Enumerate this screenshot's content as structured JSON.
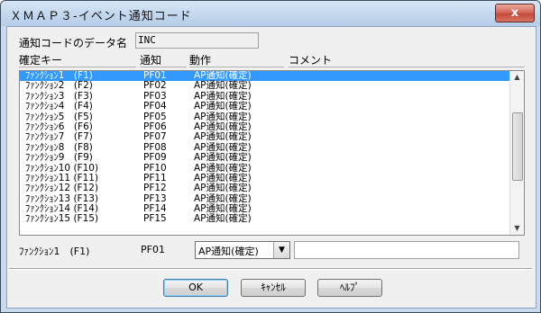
{
  "window": {
    "title": "ＸＭＡＰ３-イベント通知コード",
    "close_glyph": "x"
  },
  "notification": {
    "label": "通知コードのデータ名",
    "value": "INC"
  },
  "table": {
    "columns": [
      "確定キー",
      "通知",
      "動作",
      "コメント"
    ],
    "rows": [
      {
        "key": "ﾌｧﾝｸｼｮﾝ1　(F1)",
        "pf": "PF01",
        "action": "AP通知(確定)"
      },
      {
        "key": "ﾌｧﾝｸｼｮﾝ2　(F2)",
        "pf": "PF02",
        "action": "AP通知(確定)"
      },
      {
        "key": "ﾌｧﾝｸｼｮﾝ3　(F3)",
        "pf": "PF03",
        "action": "AP通知(確定)"
      },
      {
        "key": "ﾌｧﾝｸｼｮﾝ4　(F4)",
        "pf": "PF04",
        "action": "AP通知(確定)"
      },
      {
        "key": "ﾌｧﾝｸｼｮﾝ5　(F5)",
        "pf": "PF05",
        "action": "AP通知(確定)"
      },
      {
        "key": "ﾌｧﾝｸｼｮﾝ6　(F6)",
        "pf": "PF06",
        "action": "AP通知(確定)"
      },
      {
        "key": "ﾌｧﾝｸｼｮﾝ7　(F7)",
        "pf": "PF07",
        "action": "AP通知(確定)"
      },
      {
        "key": "ﾌｧﾝｸｼｮﾝ8　(F8)",
        "pf": "PF08",
        "action": "AP通知(確定)"
      },
      {
        "key": "ﾌｧﾝｸｼｮﾝ9　(F9)",
        "pf": "PF09",
        "action": "AP通知(確定)"
      },
      {
        "key": "ﾌｧﾝｸｼｮﾝ10 (F10)",
        "pf": "PF10",
        "action": "AP通知(確定)"
      },
      {
        "key": "ﾌｧﾝｸｼｮﾝ11 (F11)",
        "pf": "PF11",
        "action": "AP通知(確定)"
      },
      {
        "key": "ﾌｧﾝｸｼｮﾝ12 (F12)",
        "pf": "PF12",
        "action": "AP通知(確定)"
      },
      {
        "key": "ﾌｧﾝｸｼｮﾝ13 (F13)",
        "pf": "PF13",
        "action": "AP通知(確定)"
      },
      {
        "key": "ﾌｧﾝｸｼｮﾝ14 (F14)",
        "pf": "PF14",
        "action": "AP通知(確定)"
      },
      {
        "key": "ﾌｧﾝｸｼｮﾝ15 (F15)",
        "pf": "PF15",
        "action": "AP通知(確定)"
      }
    ],
    "selected_index": 0
  },
  "edit": {
    "key": "ﾌｧﾝｸｼｮﾝ1　(F1)",
    "pf": "PF01",
    "action_selected": "AP通知(確定)",
    "comment": ""
  },
  "buttons": {
    "ok": "OK",
    "cancel": "ｷｬﾝｾﾙ",
    "help": "ﾍﾙﾌﾟ"
  },
  "icons": {
    "close": "close-icon",
    "scroll_up": "chevron-up-icon",
    "scroll_down": "chevron-down-icon",
    "dropdown": "chevron-down-icon"
  },
  "colors": {
    "selection": "#3399ff",
    "close_button": "#c44a3c"
  }
}
